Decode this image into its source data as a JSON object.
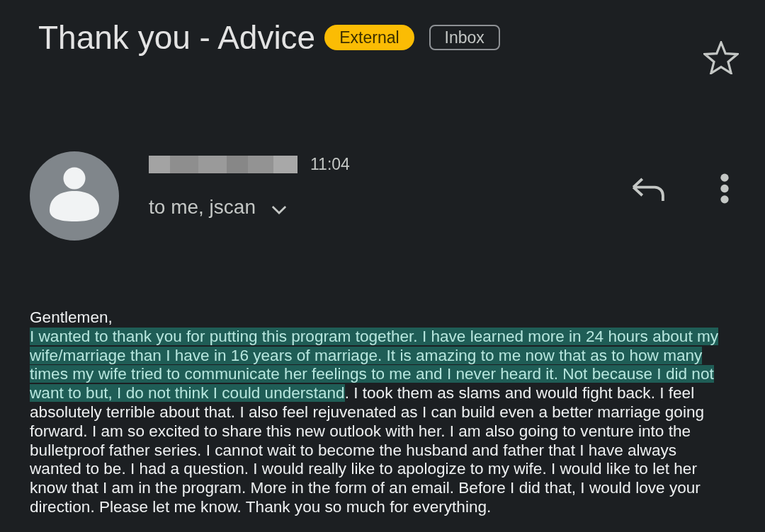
{
  "email": {
    "subject": "Thank you - Advice",
    "labels": [
      {
        "text": "External",
        "kind": "external"
      },
      {
        "text": "Inbox",
        "kind": "folder"
      }
    ],
    "starred": false,
    "sender": {
      "name_redacted": true,
      "time": "11:04",
      "recipients": "to me, jscan"
    },
    "body": {
      "greeting": "Gentlemen,",
      "segments": [
        {
          "text": "I wanted to thank you for putting this program together. I have learned more in 24 hours about my wife/marriage than I have in 16 years of marriage. It is amazing to me now that as to how many times my wife tried to communicate her feelings to me and I never heard it. Not because I did not want to but, I do not think I could understand",
          "highlighted": true
        },
        {
          "text": ". I took them as slams and would fight back. I feel absolutely terrible about that. I also feel rejuvenated as I can build even a better marriage going forward. I am so excited to share this new outlook with her. I am also going to venture into the bulletproof father series. I cannot wait to become the husband and father that I have always wanted to be. I had a question. I would really like to apologize to my wife. I would like to let her know that I am in the program. More in the form of an email. Before I did that, I would love your direction. Please let me know. Thank you so much for everything.",
          "highlighted": false
        }
      ]
    }
  }
}
